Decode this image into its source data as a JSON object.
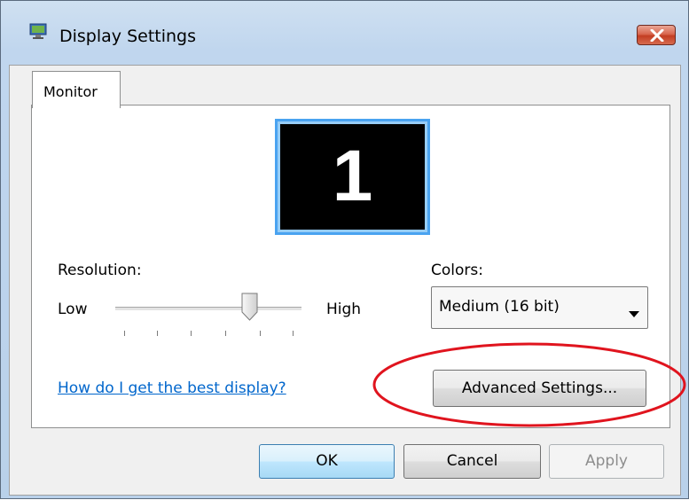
{
  "window": {
    "title": "Display Settings",
    "close_label": "close"
  },
  "tabs": [
    {
      "label": "Monitor",
      "selected": true
    }
  ],
  "monitor_preview": {
    "number": "1",
    "selected": true
  },
  "resolution": {
    "label": "Resolution:",
    "low_label": "Low",
    "high_label": "High",
    "slider_level": 0.72
  },
  "colors": {
    "label": "Colors:",
    "selected_value": "Medium (16 bit)"
  },
  "help_link": "How do I get the best display?",
  "buttons": {
    "advanced": "Advanced Settings...",
    "ok": "OK",
    "cancel": "Cancel",
    "apply": "Apply"
  },
  "annotation": {
    "shape": "ellipse",
    "color": "#e0141e",
    "target": "advanced-settings-button"
  },
  "theme": {
    "title_bar": "#c0d6ee",
    "link_color": "#0066cc",
    "monitor_border": "#4aa3f0",
    "close_button": "#c33d22"
  }
}
